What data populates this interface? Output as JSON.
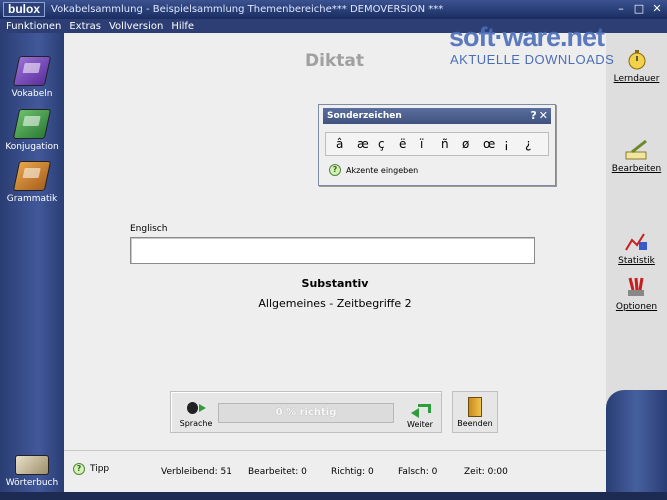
{
  "window": {
    "logo": "bulox",
    "title": "Vokabelsammlung - Beispielsammlung Themenbereiche*** DEMOVERSION ***"
  },
  "menu": [
    "Funktionen",
    "Extras",
    "Vollversion",
    "Hilfe"
  ],
  "watermark": {
    "main": "soft·ware.net",
    "sub": "AKTUELLE DOWNLOADS"
  },
  "left_nav": {
    "vokabeln": "Vokabeln",
    "konjugation": "Konjugation",
    "grammatik": "Grammatik",
    "woerterbuch": "Wörterbuch"
  },
  "right_nav": {
    "lerndauer": "Lerndauer",
    "bearbeiten": "Bearbeiten",
    "statistik": "Statistik",
    "optionen": "Optionen"
  },
  "page": {
    "title": "Diktat"
  },
  "sonderzeichen": {
    "title": "Sonderzeichen",
    "help_btn": "?",
    "close_btn": "✕",
    "chars": [
      "â",
      "æ",
      "ç",
      "ë",
      "ï",
      "ñ",
      "ø",
      "œ",
      "¡",
      "¿"
    ],
    "tip": "Akzente eingeben"
  },
  "input": {
    "label": "Englisch",
    "value": ""
  },
  "word": {
    "type": "Substantiv",
    "category": "Allgemeines - Zeitbegriffe 2"
  },
  "toolbar": {
    "sprache": "Sprache",
    "progress_text": "0 % richtig",
    "progress_fraction": 0,
    "weiter": "Weiter",
    "beenden": "Beenden"
  },
  "status": {
    "tipp": "Tipp",
    "verbleibend": "Verbleibend:  51",
    "bearbeitet": "Bearbeitet:  0",
    "richtig": "Richtig:  0",
    "falsch": "Falsch:  0",
    "zeit": "Zeit:  0:00"
  }
}
